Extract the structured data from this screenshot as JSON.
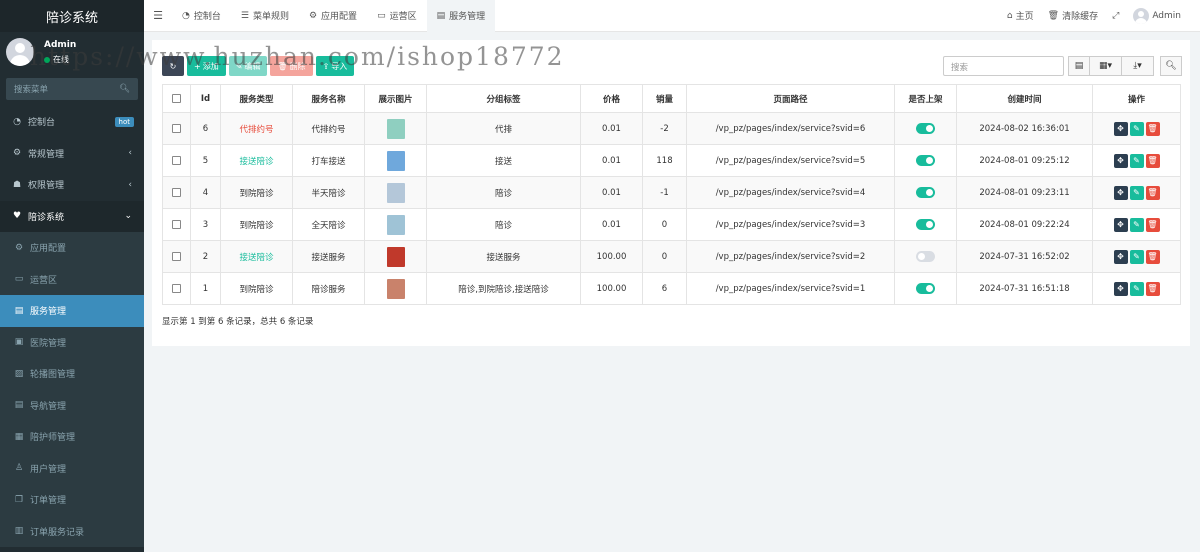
{
  "brand": "陪诊系统",
  "user": {
    "name": "Admin",
    "status": "在线"
  },
  "sidebar_search_placeholder": "搜索菜单",
  "sidebar": {
    "items": [
      {
        "label": "控制台",
        "badge": "hot"
      },
      {
        "label": "常规管理",
        "arrow": "‹"
      },
      {
        "label": "权限管理",
        "arrow": "‹"
      },
      {
        "label": "陪诊系统",
        "arrow": "⌄"
      },
      {
        "label": "应用配置"
      },
      {
        "label": "运营区"
      },
      {
        "label": "服务管理"
      },
      {
        "label": "医院管理"
      },
      {
        "label": "轮播图管理"
      },
      {
        "label": "导航管理"
      },
      {
        "label": "陪护师管理"
      },
      {
        "label": "用户管理"
      },
      {
        "label": "订单管理"
      },
      {
        "label": "订单服务记录"
      }
    ]
  },
  "header": {
    "tabs": [
      {
        "label": "控制台"
      },
      {
        "label": "菜单规则"
      },
      {
        "label": "应用配置"
      },
      {
        "label": "运营区"
      },
      {
        "label": "服务管理"
      }
    ],
    "home": "主页",
    "clear_cache": "清除缓存",
    "admin": "Admin"
  },
  "toolbar": {
    "add": "添加",
    "edit": "编辑",
    "delete": "删除",
    "import": "导入",
    "search_placeholder": "搜索"
  },
  "table": {
    "columns": [
      "Id",
      "服务类型",
      "服务名称",
      "展示图片",
      "分组标签",
      "价格",
      "销量",
      "页面路径",
      "是否上架",
      "创建时间",
      "操作"
    ],
    "rows": [
      {
        "id": "6",
        "type": "代排约号",
        "type_color": "#e74c3c",
        "name": "代排约号",
        "thumb": "#8fcfc0",
        "tag": "代排",
        "price": "0.01",
        "sales": "-2",
        "path": "/vp_pz/pages/index/service?svid=6",
        "on": true,
        "created": "2024-08-02 16:36:01"
      },
      {
        "id": "5",
        "type": "接送陪诊",
        "type_color": "#18bc9c",
        "name": "打车接送",
        "thumb": "#6fa8dc",
        "tag": "接送",
        "price": "0.01",
        "sales": "118",
        "path": "/vp_pz/pages/index/service?svid=5",
        "on": true,
        "created": "2024-08-01 09:25:12"
      },
      {
        "id": "4",
        "type": "到院陪诊",
        "type_color": "#333333",
        "name": "半天陪诊",
        "thumb": "#b4c7d9",
        "tag": "陪诊",
        "price": "0.01",
        "sales": "-1",
        "path": "/vp_pz/pages/index/service?svid=4",
        "on": true,
        "created": "2024-08-01 09:23:11"
      },
      {
        "id": "3",
        "type": "到院陪诊",
        "type_color": "#333333",
        "name": "全天陪诊",
        "thumb": "#9fc3d6",
        "tag": "陪诊",
        "price": "0.01",
        "sales": "0",
        "path": "/vp_pz/pages/index/service?svid=3",
        "on": true,
        "created": "2024-08-01 09:22:24"
      },
      {
        "id": "2",
        "type": "接送陪诊",
        "type_color": "#18bc9c",
        "name": "接送服务",
        "thumb": "#c0392b",
        "tag": "接送服务",
        "price": "100.00",
        "sales": "0",
        "path": "/vp_pz/pages/index/service?svid=2",
        "on": false,
        "created": "2024-07-31 16:52:02"
      },
      {
        "id": "1",
        "type": "到院陪诊",
        "type_color": "#333333",
        "name": "陪诊服务",
        "thumb": "#c9826b",
        "tag": "陪诊,到院陪诊,接送陪诊",
        "price": "100.00",
        "sales": "6",
        "path": "/vp_pz/pages/index/service?svid=1",
        "on": true,
        "created": "2024-07-31 16:51:18"
      }
    ]
  },
  "pager_text": "显示第 1 到第 6 条记录，总共 6 条记录",
  "watermark": "https://www.huzhan.com/ishop18772"
}
